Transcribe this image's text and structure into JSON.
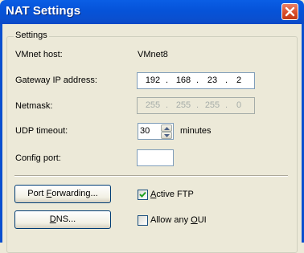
{
  "window": {
    "title": "NAT Settings",
    "close_icon": "close-icon"
  },
  "settings": {
    "group_label": "Settings",
    "vmnet_host": {
      "label": "VMnet host:",
      "value": "VMnet8"
    },
    "gateway_ip": {
      "label": "Gateway IP address:",
      "octets": [
        "192",
        "168",
        "23",
        "2"
      ]
    },
    "netmask": {
      "label": "Netmask:",
      "octets": [
        "255",
        "255",
        "255",
        "0"
      ]
    },
    "udp_timeout": {
      "label": "UDP timeout:",
      "value": "30",
      "unit": "minutes"
    },
    "config_port": {
      "label": "Config port:",
      "value": ""
    },
    "port_forwarding_button": {
      "label_pre": "Port ",
      "label_mnemonic": "F",
      "label_post": "orwarding..."
    },
    "dns_button": {
      "label_pre": "",
      "label_mnemonic": "D",
      "label_post": "NS..."
    },
    "active_ftp": {
      "label_pre": "",
      "label_mnemonic": "A",
      "label_post": "ctive FTP",
      "checked": true
    },
    "allow_any_oui": {
      "label_pre": "Allow any ",
      "label_mnemonic": "O",
      "label_post": "UI",
      "checked": false
    }
  },
  "colors": {
    "titlebar": "#0a5ee5",
    "dialog_bg": "#ece9d8",
    "close_button": "#d64a27"
  }
}
